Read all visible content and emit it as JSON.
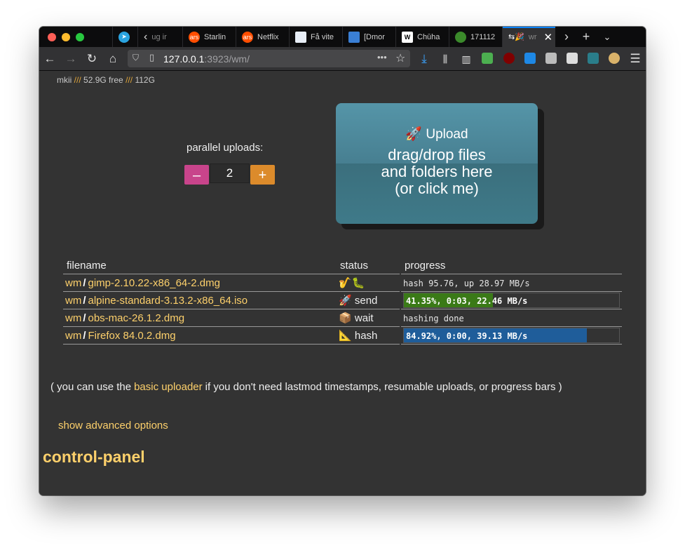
{
  "tabs": [
    {
      "label": "",
      "icon": "telegram-icon"
    },
    {
      "label": "ug ir",
      "icon": "chevron-left-icon"
    },
    {
      "label": "Starlin",
      "icon": "ars-icon"
    },
    {
      "label": "Netflix",
      "icon": "ars-icon"
    },
    {
      "label": "Få vite",
      "icon": "document-icon"
    },
    {
      "label": "[Dmor",
      "icon": "app-icon"
    },
    {
      "label": "Chūha",
      "icon": "wikipedia-icon"
    },
    {
      "label": "171112",
      "icon": "bug-icon"
    },
    {
      "label": "wr",
      "icon": "party-icon"
    }
  ],
  "tab_ars_badge": "ars",
  "tab_wiki_badge": "W",
  "url": {
    "host": "127.0.0.1",
    "rest": ":3923/wm/"
  },
  "disk": {
    "name": "mkii",
    "sep": "///",
    "free": "52.9G free",
    "total": "112G"
  },
  "parallel": {
    "label": "parallel uploads:",
    "value": "2",
    "minus": "–",
    "plus": "+"
  },
  "dropzone": {
    "line1": "Upload",
    "line2": "drag/drop files",
    "line3": "and folders here",
    "line4": "(or click me)"
  },
  "table": {
    "headers": {
      "file": "filename",
      "status": "status",
      "progress": "progress"
    },
    "rows": [
      {
        "dir": "wm",
        "name": "gimp-2.10.22-x86_64-2.dmg",
        "status_icon": "🎷🐛",
        "status": "",
        "progress_text": "hash 95.76, up 28.97 MB/s",
        "percent": null,
        "bar_color": ""
      },
      {
        "dir": "wm",
        "name": "alpine-standard-3.13.2-x86_64.iso",
        "status_icon": "🚀",
        "status": "send",
        "progress_text": "41.35%, 0:03, 22.46 MB/s",
        "percent": 41.35,
        "bar_color": "#3a7a17"
      },
      {
        "dir": "wm",
        "name": "obs-mac-26.1.2.dmg",
        "status_icon": "📦",
        "status": "wait",
        "progress_text": "hashing done",
        "percent": null,
        "bar_color": ""
      },
      {
        "dir": "wm",
        "name": "Firefox 84.0.2.dmg",
        "status_icon": "📐",
        "status": "hash",
        "progress_text": "84.92%, 0:00, 39.13 MB/s",
        "percent": 84.92,
        "bar_color": "#1f5d9a"
      }
    ]
  },
  "info": {
    "prefix": "( you can use the",
    "link": "basic uploader",
    "suffix": "if you don't need lastmod timestamps, resumable uploads, or progress bars )"
  },
  "advanced": "show advanced options",
  "control_panel": "control-panel"
}
